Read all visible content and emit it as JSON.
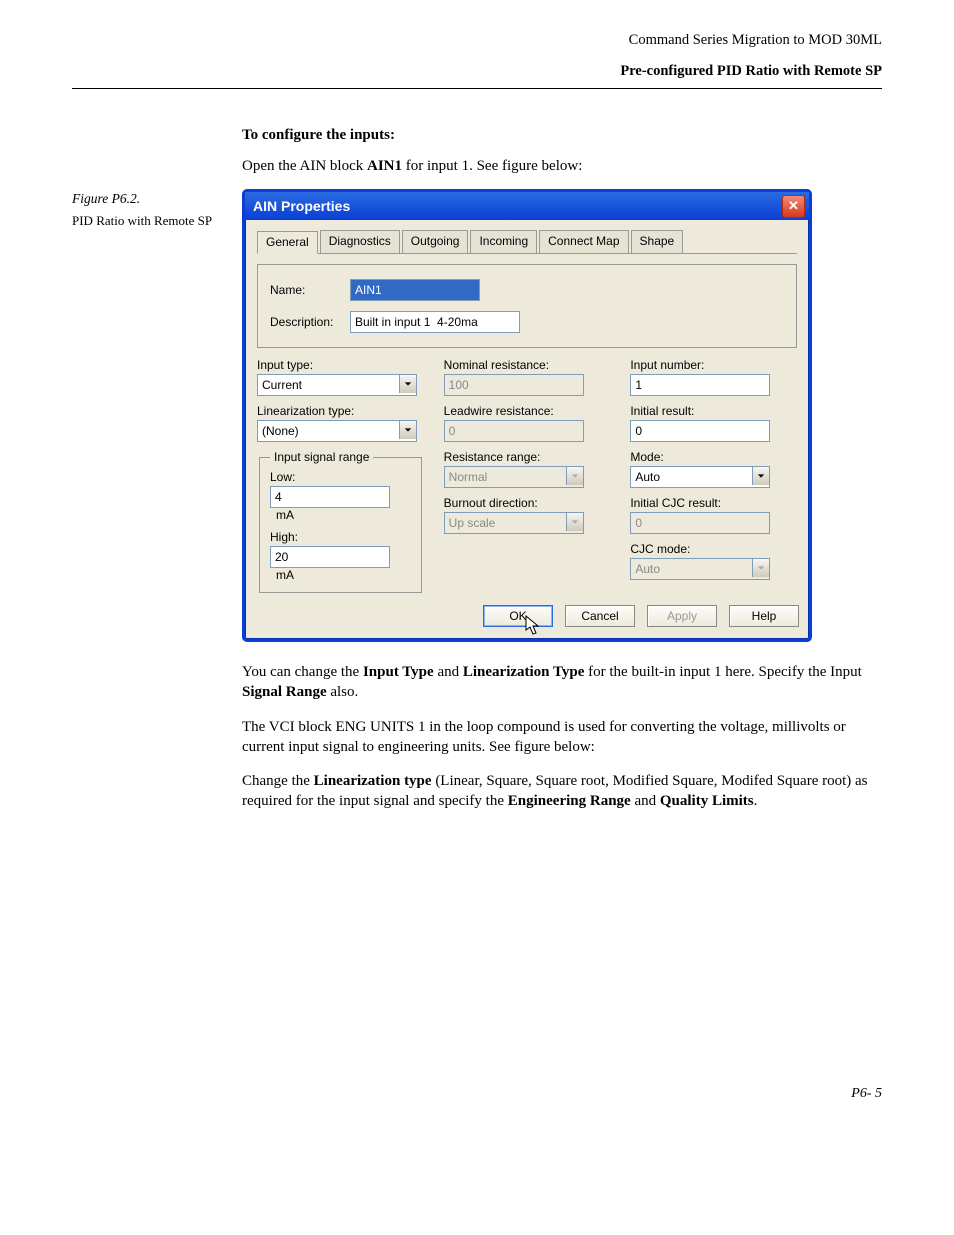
{
  "header": {
    "top": "Command Series Migration to MOD 30ML",
    "sub": "Pre-configured PID Ratio with Remote SP"
  },
  "sidenote": {
    "figure_label": "Figure P6.2.",
    "caption": "PID Ratio with Remote SP"
  },
  "intro": {
    "heading": "To configure the inputs:",
    "open_pre": "Open the AIN block ",
    "open_bold": "AIN1",
    "open_post": " for input 1. See figure below:"
  },
  "dialog": {
    "title": "AIN Properties",
    "tabs": [
      "General",
      "Diagnostics",
      "Outgoing",
      "Incoming",
      "Connect Map",
      "Shape"
    ],
    "active_tab": 0,
    "name_label": "Name:",
    "name_value": "AIN1",
    "desc_label": "Description:",
    "desc_value": "Built in input 1  4-20ma",
    "col1": {
      "input_type_label": "Input type:",
      "input_type_value": "Current",
      "lin_type_label": "Linearization type:",
      "lin_type_value": "(None)",
      "range_legend": "Input signal range",
      "low_label": "Low:",
      "low_value": "4",
      "high_label": "High:",
      "high_value": "20",
      "unit": "mA"
    },
    "col2": {
      "nom_res_label": "Nominal resistance:",
      "nom_res_value": "100",
      "lead_res_label": "Leadwire resistance:",
      "lead_res_value": "0",
      "res_range_label": "Resistance range:",
      "res_range_value": "Normal",
      "burnout_label": "Burnout direction:",
      "burnout_value": "Up scale"
    },
    "col3": {
      "in_num_label": "Input number:",
      "in_num_value": "1",
      "init_res_label": "Initial result:",
      "init_res_value": "0",
      "mode_label": "Mode:",
      "mode_value": "Auto",
      "init_cjc_label": "Initial CJC result:",
      "init_cjc_value": "0",
      "cjc_mode_label": "CJC mode:",
      "cjc_mode_value": "Auto"
    },
    "buttons": {
      "ok": "OK",
      "cancel": "Cancel",
      "apply": "Apply",
      "help": "Help"
    }
  },
  "after": {
    "p1_a": "You can change the ",
    "p1_b1": "Input Type",
    "p1_c": " and ",
    "p1_b2": "Linearization Type",
    "p1_d": " for the built-in input 1 here. Specify the Input ",
    "p1_b3": "Signal Range",
    "p1_e": " also.",
    "p2": "The VCI block ENG UNITS 1 in the loop compound is used for converting the voltage, millivolts or current input signal to engineering units. See figure below:",
    "p3_a": "Change the ",
    "p3_b1": "Linearization type",
    "p3_c": " (Linear, Square, Square root, Modified Square, Modifed Square root) as required for the input signal and specify the ",
    "p3_b2": "Engineering Range",
    "p3_d": " and ",
    "p3_b3": "Quality Limits",
    "p3_e": "."
  },
  "page_number": "P6- 5"
}
